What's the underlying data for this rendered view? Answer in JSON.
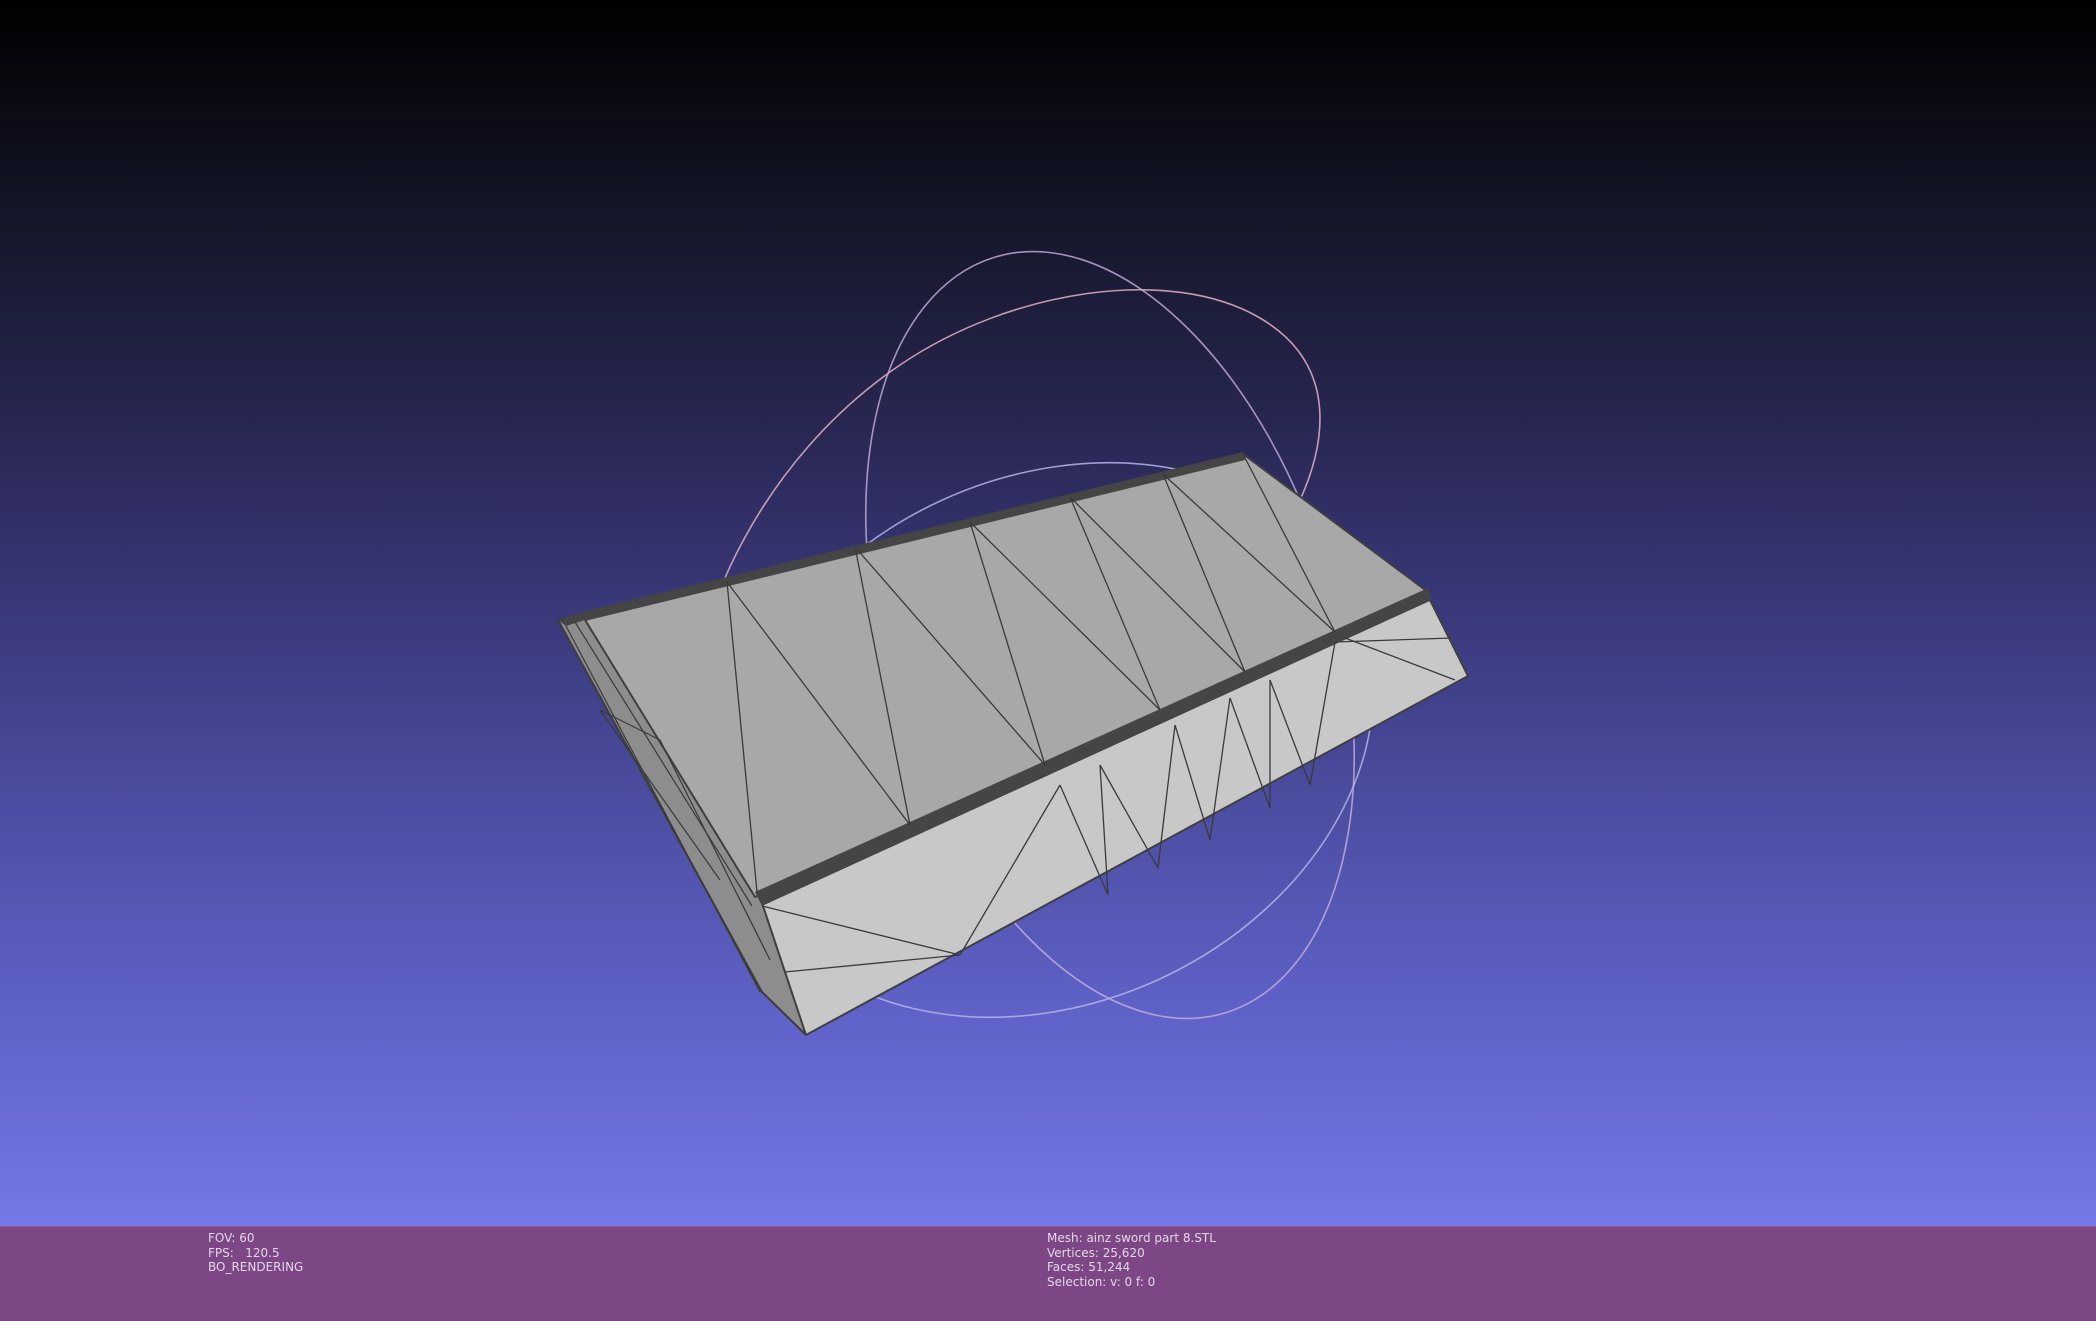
{
  "viewport": {
    "background_top": "#000000",
    "background_bottom": "#7478e8",
    "mesh_face_color": "#a9a9a9",
    "mesh_edge_color": "#3f3f3f",
    "trackball_colors": [
      "#c4a3d0",
      "#d3a3b6",
      "#b6b8e3"
    ]
  },
  "status_left": {
    "fov": "FOV: 60",
    "fps": "FPS:   120.5",
    "mode": "BO_RENDERING"
  },
  "status_right": {
    "mesh": "Mesh: ainz sword part 8.STL",
    "vertices": "Vertices: 25,620",
    "faces": "Faces: 51,244",
    "selection": "Selection: v: 0 f: 0"
  },
  "status_bar_color": "#7d4786"
}
